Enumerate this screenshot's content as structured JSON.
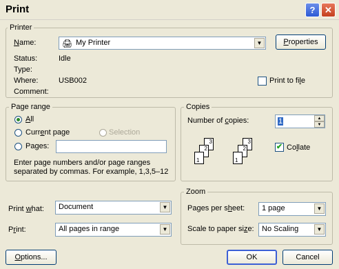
{
  "window": {
    "title": "Print"
  },
  "printer": {
    "legend": "Printer",
    "name_label": "Name:",
    "name_value": "My Printer",
    "properties_label": "Properties",
    "status_label": "Status:",
    "status_value": "Idle",
    "type_label": "Type:",
    "where_label": "Where:",
    "where_value": "USB002",
    "comment_label": "Comment:",
    "print_to_file_label": "Print to file"
  },
  "page_range": {
    "legend": "Page range",
    "all_label": "All",
    "current_label": "Current page",
    "selection_label": "Selection",
    "pages_label": "Pages:",
    "hint_line1": "Enter page numbers and/or page ranges",
    "hint_line2": "separated by commas.  For example, 1,3,5–12"
  },
  "copies": {
    "legend": "Copies",
    "number_label": "Number of copies:",
    "number_value": "1",
    "collate_label": "Collate",
    "collate_pages": [
      "1",
      "2",
      "3"
    ]
  },
  "print_what": {
    "label": "Print what:",
    "value": "Document"
  },
  "print": {
    "label": "Print:",
    "value": "All pages in range"
  },
  "zoom": {
    "legend": "Zoom",
    "pages_per_sheet_label": "Pages per sheet:",
    "pages_per_sheet_value": "1 page",
    "scale_label": "Scale to paper size:",
    "scale_value": "No Scaling"
  },
  "buttons": {
    "options": "Options...",
    "ok": "OK",
    "cancel": "Cancel"
  }
}
